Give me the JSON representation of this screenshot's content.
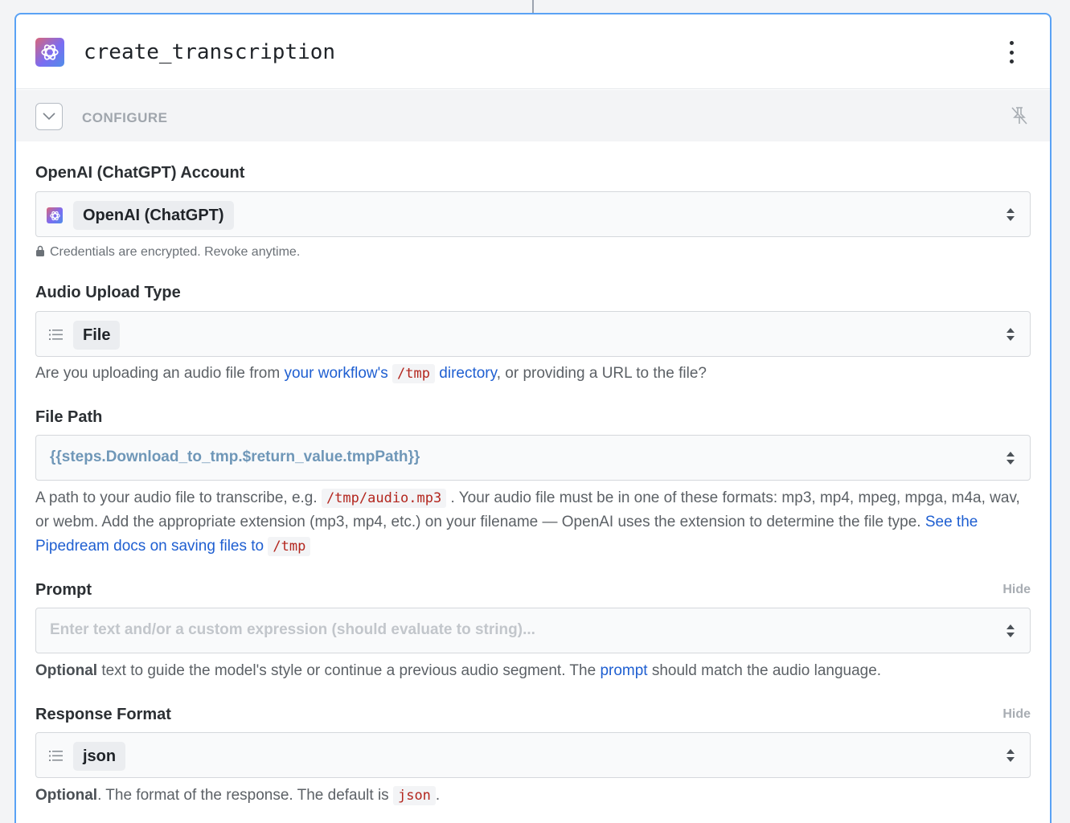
{
  "step": {
    "title": "create_transcription"
  },
  "configure": {
    "label": "CONFIGURE"
  },
  "fields": {
    "account": {
      "label": "OpenAI (ChatGPT) Account",
      "value": "OpenAI (ChatGPT)",
      "note": "Credentials are encrypted. Revoke anytime."
    },
    "upload_type": {
      "label": "Audio Upload Type",
      "value": "File",
      "desc_1": "Are you uploading an audio file from ",
      "desc_link_1": "your workflow's",
      "desc_code": "/tmp",
      "desc_link_2": "directory",
      "desc_2": ", or providing a URL to the file?"
    },
    "file_path": {
      "label": "File Path",
      "value": "{{steps.Download_to_tmp.$return_value.tmpPath}}",
      "desc_1": "A path to your audio file to transcribe, e.g. ",
      "desc_code_1": "/tmp/audio.mp3",
      "desc_2": ". Your audio file must be in one of these formats: mp3, mp4, mpeg, mpga, m4a, wav, or webm. Add the appropriate extension (mp3, mp4, etc.) on your filename — OpenAI uses the extension to determine the file type. ",
      "desc_link": "See the Pipedream docs on saving files to",
      "desc_code_2": "/tmp"
    },
    "prompt": {
      "label": "Prompt",
      "hide": "Hide",
      "placeholder": "Enter text and/or a custom expression (should evaluate to string)...",
      "desc_bold": "Optional",
      "desc_1": " text to guide the model's style or continue a previous audio segment. The ",
      "desc_link": "prompt",
      "desc_2": " should match the audio language."
    },
    "response_format": {
      "label": "Response Format",
      "hide": "Hide",
      "value": "json",
      "desc_bold": "Optional",
      "desc_1": ". The format of the response. The default is ",
      "desc_code": "json",
      "desc_2": "."
    }
  },
  "icons": {
    "app": "openai-logo-icon",
    "menu": "kebab-menu-icon",
    "collapse": "chevron-down-icon",
    "pin": "unpin-icon",
    "lock": "lock-icon",
    "list": "list-icon",
    "select": "select-arrows-icon"
  },
  "colors": {
    "accent_border": "#5aa2f5",
    "link": "#1f5fd1",
    "code": "#b3261e",
    "expression": "#6f97b8"
  }
}
